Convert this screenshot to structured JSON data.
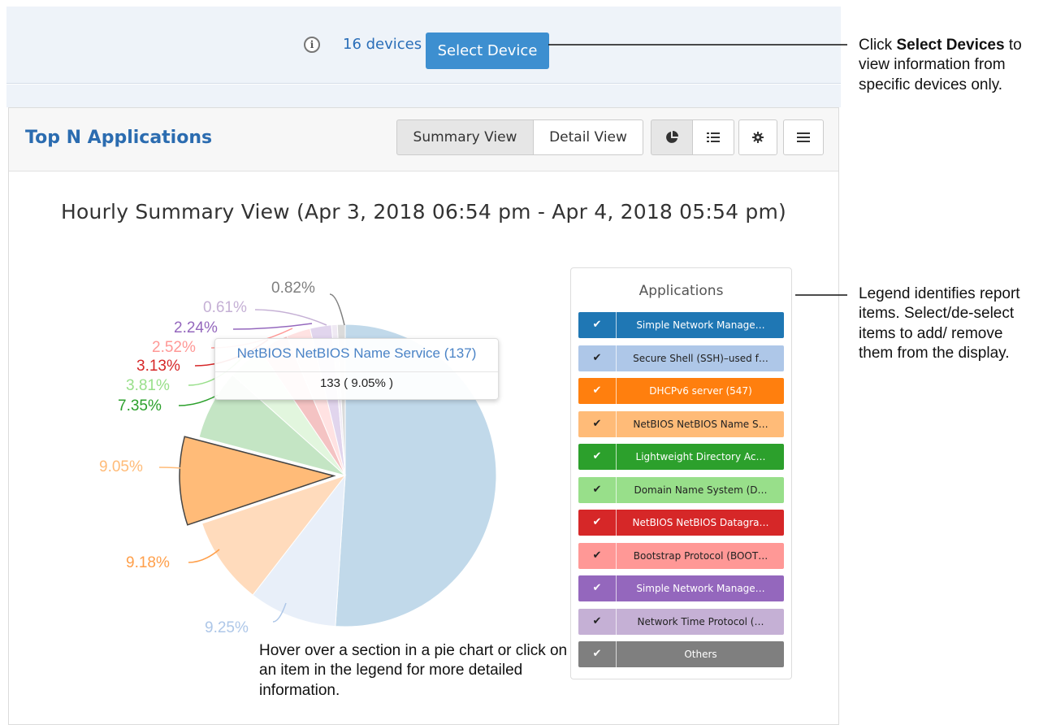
{
  "device_bar": {
    "devices_link": "16 devices",
    "select_button": "Select Device"
  },
  "panel": {
    "title": "Top N Applications",
    "view_buttons": {
      "summary": "Summary View",
      "detail": "Detail View"
    },
    "icons": [
      "pie-chart-icon",
      "list-icon",
      "gear-icon",
      "menu-icon"
    ]
  },
  "chart_data": {
    "type": "pie",
    "title": "Hourly Summary View (Apr 3, 2018 06:54 pm - Apr 4, 2018 05:54 pm)",
    "legend_title": "Applications",
    "legend_position": "right",
    "slices": [
      {
        "name": "Simple Network Manage…",
        "value": 50.0,
        "label": "",
        "color": "#1f77b4"
      },
      {
        "name": "Secure Shell (SSH)–used f…",
        "value": 9.25,
        "label": "9.25%",
        "color": "#aec7e8"
      },
      {
        "name": "DHCPv6 server (547)",
        "value": 9.18,
        "label": "9.18%",
        "color": "#ff7f0e"
      },
      {
        "name": "NetBIOS NetBIOS Name S…",
        "value": 9.05,
        "label": "9.05%",
        "color": "#ffbb78"
      },
      {
        "name": "Lightweight Directory Ac…",
        "value": 7.35,
        "label": "7.35%",
        "color": "#2ca02c"
      },
      {
        "name": "Domain Name System (D…",
        "value": 3.81,
        "label": "3.81%",
        "color": "#98df8a"
      },
      {
        "name": "NetBIOS NetBIOS Datagra…",
        "value": 3.13,
        "label": "3.13%",
        "color": "#d62728"
      },
      {
        "name": "Bootstrap Protocol (BOOT…",
        "value": 2.52,
        "label": "2.52%",
        "color": "#ff9896"
      },
      {
        "name": "Simple Network Manage…",
        "value": 2.24,
        "label": "2.24%",
        "color": "#9467bd"
      },
      {
        "name": "Network Time Protocol (…",
        "value": 0.61,
        "label": "0.61%",
        "color": "#c5b0d5"
      },
      {
        "name": "Others",
        "value": 0.82,
        "label": "0.82%",
        "color": "#7f7f7f"
      }
    ],
    "highlighted_index": 3
  },
  "tooltip": {
    "title": "NetBIOS NetBIOS Name Service (137)",
    "value": "133 ( 9.05% )"
  },
  "annotations": {
    "select_devices": {
      "pre": "Click ",
      "bold": "Select Devices",
      "post": " to view information from specific devices only."
    },
    "legend": "Legend identifies report items. Select/de-select items to add/ remove them from the display.",
    "hover": "Hover over a section in a pie chart or click on an item in the legend for more detailed information."
  }
}
